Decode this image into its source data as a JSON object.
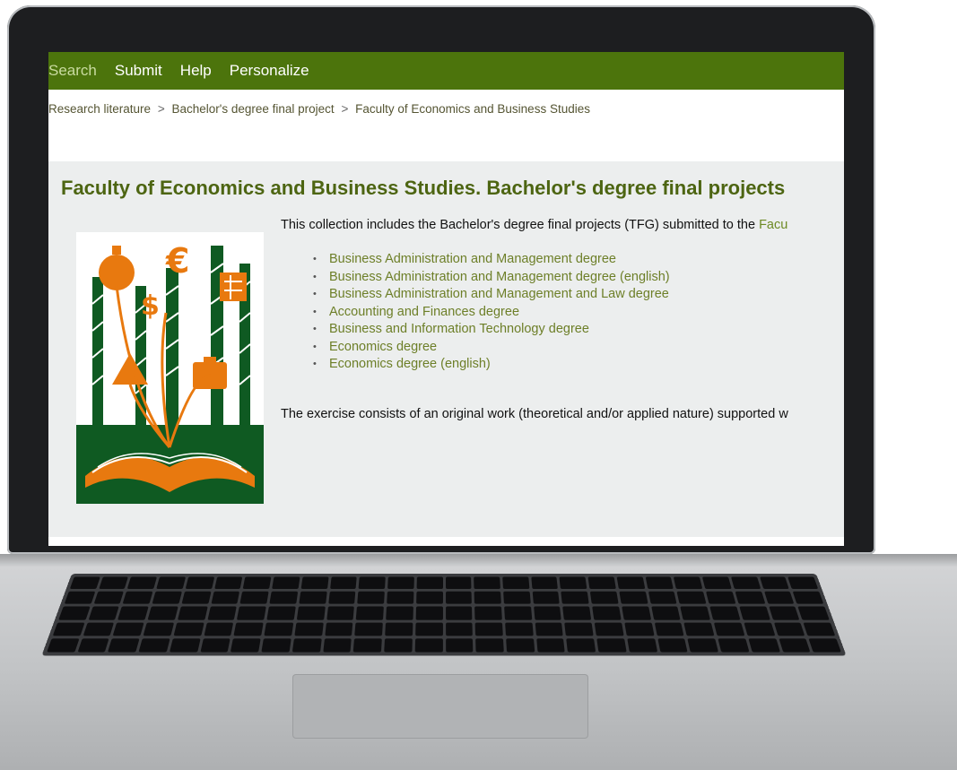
{
  "nav": {
    "search": "Search",
    "submit": "Submit",
    "help": "Help",
    "personalize": "Personalize"
  },
  "breadcrumb": {
    "items": [
      "Research literature",
      "Bachelor's degree final project",
      "Faculty of Economics and Business Studies"
    ],
    "separator": ">"
  },
  "page": {
    "title": "Faculty of Economics and Business Studies. Bachelor's degree final projects",
    "intro_text": "This collection includes the Bachelor's degree final projects (TFG) submitted to the ",
    "intro_link": "Facu",
    "degrees": [
      "Business Administration and Management degree",
      "Business Administration and Management degree (english)",
      "Business Administration and Management and Law degree",
      "Accounting and Finances degree",
      "Business and Information Technology degree",
      "Economics degree",
      "Economics degree (english)"
    ],
    "exercise_text": "The exercise consists of an original work (theoretical and/or applied nature) supported w"
  },
  "colors": {
    "navbar": "#4c740c",
    "title": "#4d6512",
    "link": "#6d7f28",
    "illustration_orange": "#e8790f",
    "illustration_green": "#0f5a22"
  }
}
